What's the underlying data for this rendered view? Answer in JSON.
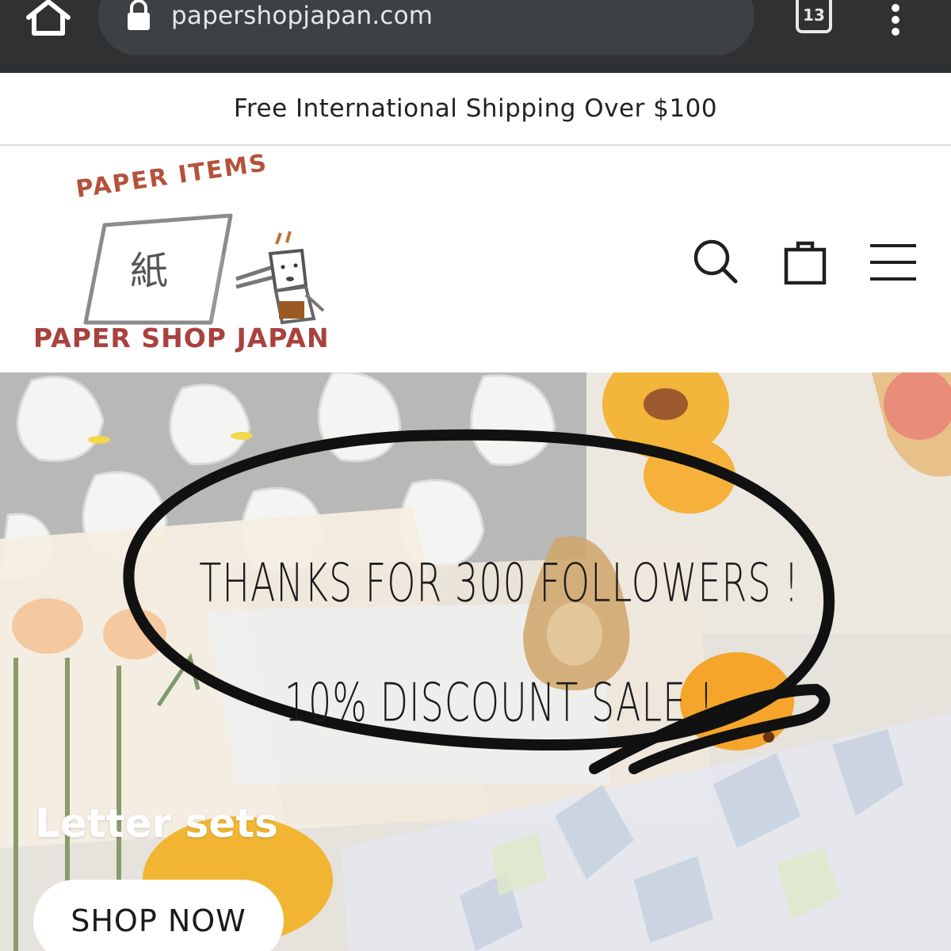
{
  "browser": {
    "url": "papershopjapan.com",
    "tab_count": "13"
  },
  "announcement": {
    "text": "Free International Shipping Over $100"
  },
  "logo": {
    "top_text": "PAPER ITEMS",
    "kanji": "紙",
    "bottom_text": "PAPER SHOP JAPAN"
  },
  "icons": {
    "home": "home-icon",
    "lock": "lock-icon",
    "tabs": "tabs-icon",
    "menu": "more-vert-icon",
    "search": "search-icon",
    "cart": "shopping-bag-icon",
    "nav": "hamburger-menu-icon"
  },
  "hero": {
    "promo_line_1": "Thanks for 300 followers !",
    "promo_line_2": "10% discount sale !",
    "collection_title": "Letter sets",
    "cta_label": "SHOP NOW"
  },
  "colors": {
    "browser_bar": "#2f3133",
    "url_pill": "#3e4144",
    "text_dark": "#222222",
    "logo_red": "#a9413d"
  }
}
